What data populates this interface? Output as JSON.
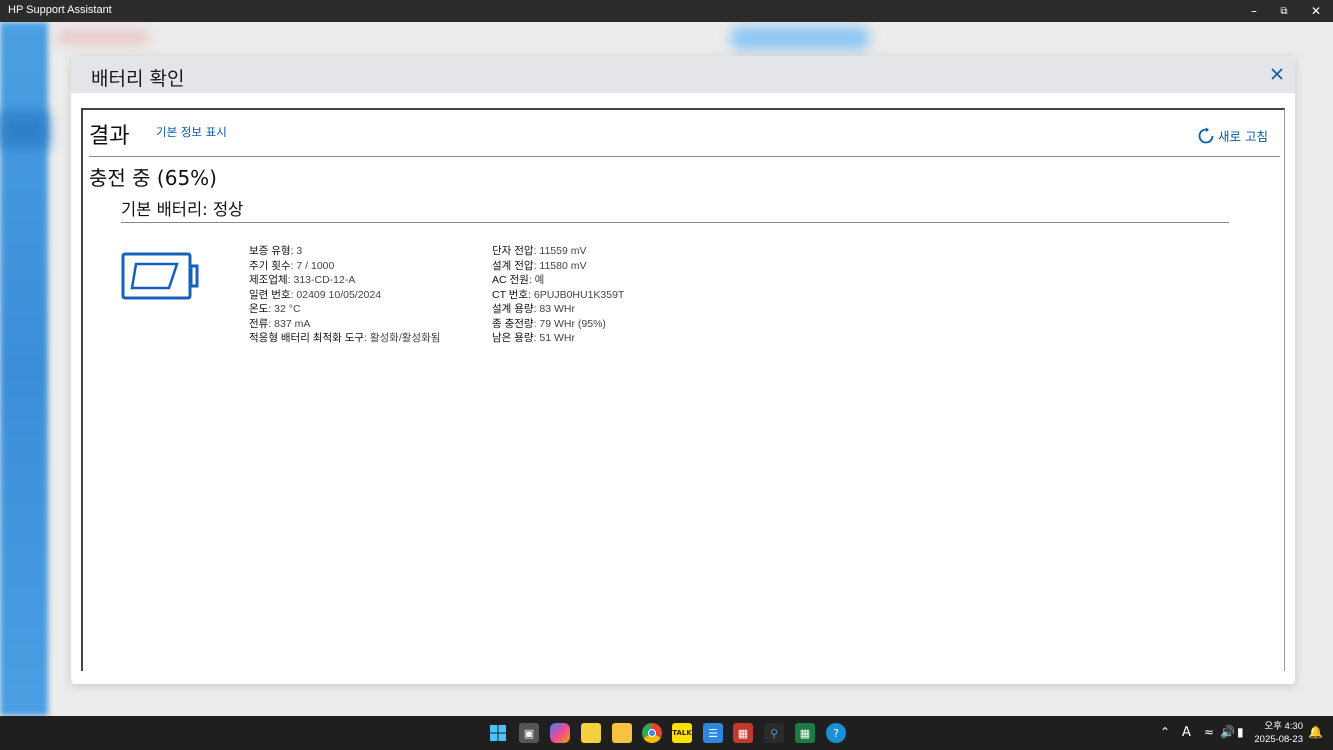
{
  "window": {
    "app_title": "HP Support Assistant",
    "controls": [
      "minimize",
      "maximize",
      "close"
    ]
  },
  "dialog": {
    "title": "배터리 확인",
    "result_title": "결과",
    "basic_info_link": "기본 정보 표시",
    "refresh_label": "새로 고침",
    "status": "충전 중 (65%)",
    "battery_heading": "기본 배터리: 정상",
    "left_info": [
      {
        "key": "보증 유형",
        "value": "3"
      },
      {
        "key": "주기 횟수",
        "value": "7 / 1000"
      },
      {
        "key": "제조업체",
        "value": "313-CD-12-A"
      },
      {
        "key": "일련 번호",
        "value": "02409 10/05/2024"
      },
      {
        "key": "온도",
        "value": "32 °C"
      },
      {
        "key": "전류",
        "value": "837 mA"
      },
      {
        "key": "적응형 배터리 최적화 도구",
        "value": "활성화/활성화됨"
      }
    ],
    "right_info": [
      {
        "key": "단자 전압",
        "value": "11559 mV"
      },
      {
        "key": "설계 전압",
        "value": "11580 mV"
      },
      {
        "key": "AC 전원",
        "value": "예"
      },
      {
        "key": "CT 번호",
        "value": "6PUJB0HU1K359T"
      },
      {
        "key": "설계 용량",
        "value": "83 WHr"
      },
      {
        "key": "종 충전량",
        "value": "79 WHr (95%)"
      },
      {
        "key": "남은 용량",
        "value": "51 WHr"
      }
    ]
  },
  "taskbar": {
    "apps": [
      "start-icon",
      "task-view-icon",
      "copilot-icon",
      "sticky-notes-icon",
      "file-explorer-icon",
      "chrome-icon",
      "kakaotalk-icon",
      "notepad-icon",
      "app-icon",
      "search-app-icon",
      "excel-icon",
      "hp-support-icon"
    ],
    "tray_ime": "A",
    "clock_time": "오후 4:30",
    "clock_date": "2025-08-23"
  },
  "colors": {
    "accent": "#0a5aa8",
    "titlebar": "#2b2b2b",
    "taskbar": "#1f1f1f",
    "battery_icon": "#1560bd"
  }
}
